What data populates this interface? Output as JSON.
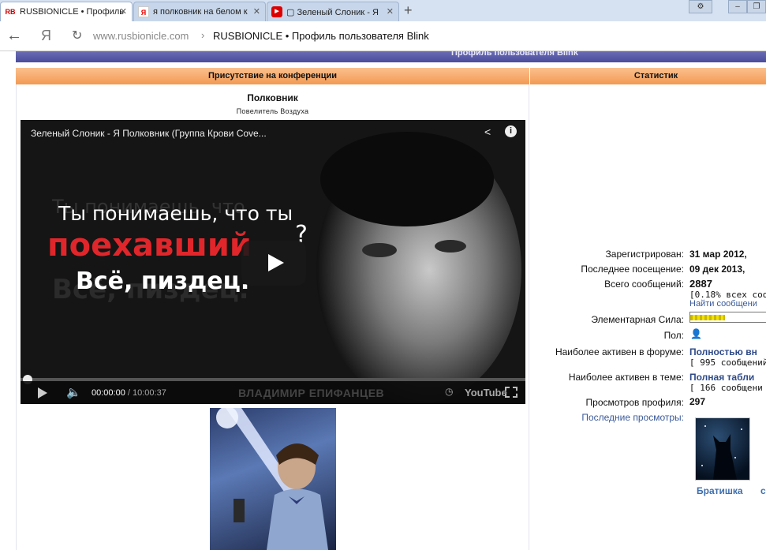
{
  "browser": {
    "tabs": [
      {
        "favicon": "RB",
        "label": "RUSBIONICLE • Профиль"
      },
      {
        "favicon": "Я",
        "label": "я полковник на белом к"
      },
      {
        "favicon": "▶",
        "label": "▢ Зеленый Слоник - Я"
      }
    ],
    "new_tab": "+",
    "url_host": "www.rusbionicle.com",
    "url_sep": "›",
    "page_title": "RUSBIONICLE • Профиль пользователя Blink",
    "yandex_btn": "Я"
  },
  "page": {
    "top_bar_title": "Профиль пользователя Blink",
    "left_header": "Присутствие на конференции",
    "right_header": "Статистик",
    "rank": "Полковник",
    "rank_subtitle": "Повелитель Воздуха"
  },
  "video": {
    "title": "Зеленый Слоник - Я Полковник (Группа Крови Cove...",
    "line1": "Ты понимаешь, что ты",
    "line2": "поехавший",
    "line2_q": "?",
    "line3": "Всё, пиздец.",
    "bg1": "Ты понимаешь, что",
    "bg2": "Всё, пиздец.",
    "time_current": "00:00:00",
    "time_total": "/ 10:00:37",
    "watermark": "ВЛАДИМИР ЕПИФАНЦЕВ",
    "youtube": "YouTube",
    "progress": 0.0
  },
  "stats": {
    "registered_label": "Зарегистрирован:",
    "registered_value": "31 мар 2012,",
    "last_visit_label": "Последнее посещение:",
    "last_visit_value": "09 дек 2013,",
    "posts_label": "Всего сообщений:",
    "posts_value": "2887",
    "posts_pct": "[0.18% всех соо",
    "find_posts": "Найти сообщени",
    "power_label": "Элементарная Сила:",
    "power_level": 0.45,
    "gender_label": "Пол:",
    "active_forum_label": "Наиболее активен в форуме:",
    "active_forum_value": "Полностью вн",
    "active_forum_sub": "[ 995 сообщений",
    "active_topic_label": "Наиболее активен в теме:",
    "active_topic_value": "Полная табли",
    "active_topic_sub": "[ 166 сообщени",
    "views_label": "Просмотров профиля:",
    "views_value": "297",
    "recent_views_label": "Последние просмотры:",
    "viewer_name": "Братишка",
    "viewer2": "c"
  },
  "colors": {
    "header_orange": "#f29a52",
    "top_bar_purple": "#4a4c9c",
    "link_blue": "#3b5a9a",
    "video_red": "#e0262b",
    "power_yellow": "#f3e200"
  }
}
